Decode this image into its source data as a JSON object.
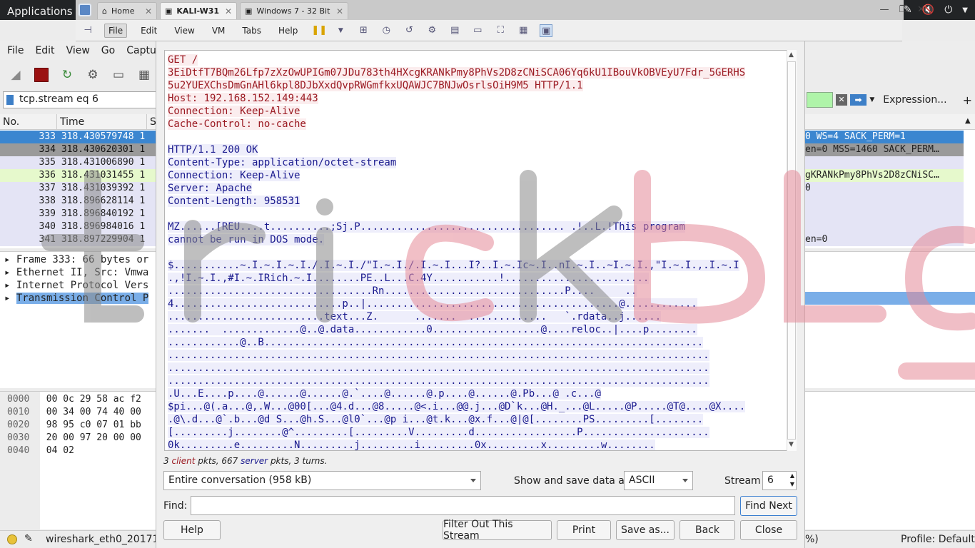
{
  "os": {
    "applications_label": "Applications"
  },
  "vm_tabs": [
    {
      "label": "Home"
    },
    {
      "label": "KALI-W31"
    },
    {
      "label": "Windows 7 - 32 Bit"
    }
  ],
  "vm_menu": [
    "File",
    "Edit",
    "View",
    "VM",
    "Tabs",
    "Help"
  ],
  "ws_menu": [
    "File",
    "Edit",
    "View",
    "Go",
    "Capture"
  ],
  "filter": {
    "text": "tcp.stream eq 6",
    "expression_label": "Expression...",
    "plus": "+"
  },
  "packet_columns": [
    "No.",
    "Time",
    "S"
  ],
  "packets": [
    {
      "no": "333",
      "time": "318.430579748",
      "src": "1"
    },
    {
      "no": "334",
      "time": "318.430620301",
      "src": "1"
    },
    {
      "no": "335",
      "time": "318.431006890",
      "src": "1"
    },
    {
      "no": "336",
      "time": "318.431031455",
      "src": "1"
    },
    {
      "no": "337",
      "time": "318.431039392",
      "src": "1"
    },
    {
      "no": "338",
      "time": "318.896628114",
      "src": "1"
    },
    {
      "no": "339",
      "time": "318.896840192",
      "src": "1"
    },
    {
      "no": "340",
      "time": "318.896984016",
      "src": "1"
    },
    {
      "no": "341",
      "time": "318.897229904",
      "src": "1"
    }
  ],
  "packet_info_right": [
    "0 WS=4 SACK_PERM=1",
    "en=0 MSS=1460 SACK_PERM…",
    "",
    "gKRANkPmy8PhVs2D8zCNiSC…",
    "0",
    "",
    "",
    "",
    "en=0"
  ],
  "details": [
    "Frame 333: 66 bytes or",
    "Ethernet II, Src: Vmwa",
    "Internet Protocol Vers",
    "Transmission Control P"
  ],
  "hex": [
    {
      "off": "0000",
      "bytes": "00 0c 29 58 ac f2"
    },
    {
      "off": "0010",
      "bytes": "00 34 00 74 40 00"
    },
    {
      "off": "0020",
      "bytes": "98 95 c0 07 01 bb"
    },
    {
      "off": "0030",
      "bytes": "20 00 97 20 00 00"
    },
    {
      "off": "0040",
      "bytes": "04 02"
    }
  ],
  "status": {
    "file": "wireshark_eth0_20171",
    "percent": "%)",
    "profile": "Profile: Default"
  },
  "stream": {
    "lines": [
      {
        "t": "c",
        "text": "GET /"
      },
      {
        "t": "c",
        "text": "3EiDtfT7BQm26Lfp7zXzOwUPIGm07JDu783th4HXcgKRANkPmy8PhVs2D8zCNiSCA06Yq6kU1IBouVkOBVEyU7Fdr_5GERHS"
      },
      {
        "t": "c",
        "text": "5u2YUEXChsDmGnAHl6kpl8DJbXxdQvpRWGmfkxUQAWJC7BNJwOsrlsOiH9M5 HTTP/1.1"
      },
      {
        "t": "c",
        "text": "Host: 192.168.152.149:443"
      },
      {
        "t": "c",
        "text": "Connection: Keep-Alive"
      },
      {
        "t": "c",
        "text": "Cache-Control: no-cache"
      },
      {
        "t": "b",
        "text": ""
      },
      {
        "t": "s",
        "text": "HTTP/1.1 200 OK"
      },
      {
        "t": "s",
        "text": "Content-Type: application/octet-stream"
      },
      {
        "t": "s",
        "text": "Connection: Keep-Alive"
      },
      {
        "t": "s",
        "text": "Server: Apache"
      },
      {
        "t": "s",
        "text": "Content-Length: 958531"
      },
      {
        "t": "b",
        "text": ""
      },
      {
        "t": "s",
        "text": "MZ......[REU....t..........;Sj.P.................................. .!..L.!This program"
      },
      {
        "t": "s",
        "text": "cannot be run in DOS mode."
      },
      {
        "t": "b",
        "text": ""
      },
      {
        "t": "s",
        "text": "$...........~.I.~.I.~.I./.I.~.I./\"I.~.I./.I.~.I...I?..I.~.Ic~.I..nI.~.I..~I.~.I.,\"I.~.I.,.I.~.I"
      },
      {
        "t": "s",
        "text": ".,!I.~.I.,#I.~.IRich.~.I........PE..L...C.4Y...........!........................"
      },
      {
        "t": "s",
        "text": "..................................Rn..............................P....     .."
      },
      {
        "t": "s",
        "text": "4............................p..|..........................................@............"
      },
      {
        "t": "s",
        "text": "..........................text...Z.      .......  .............   `.rdata..j......"
      },
      {
        "t": "s",
        "text": ".......  .............@..@.data............0..................@....reloc..|....p........"
      },
      {
        "t": "s",
        "text": "............@..B........................................................................."
      },
      {
        "t": "s",
        "text": ".........................................................................................."
      },
      {
        "t": "s",
        "text": ".........................................................................................."
      },
      {
        "t": "s",
        "text": ".........................................................................................."
      },
      {
        "t": "s",
        "text": ".U...E....p....@......@......@.`....@......@.p....@......@.Pb...@ .c...@"
      },
      {
        "t": "s",
        "text": "$pi...@(.a...@,.W...@00[...@4.d...@8.....@<.i...@@.j...@D`k...@H._...@L.....@P.....@T@....@X...."
      },
      {
        "t": "s",
        "text": ".@\\.d...@`.b...@d S...@h.S...@l0`...@p i...@t.k...@x.f...@|@[........PS.........[........"
      },
      {
        "t": "s",
        "text": "[.........j........@^.........[.........V.........d.................P....................."
      },
      {
        "t": "s",
        "text": "0k.........e.........N.........j.........i.........0x.........x.........w........"
      }
    ],
    "summary": {
      "client_count": "3",
      "client_word": "client",
      "mid": " pkts, 667 ",
      "server_word": "server",
      "tail": " pkts, 3 turns."
    },
    "conversation": "Entire conversation (958 kB)",
    "show_label": "Show and save data as",
    "format": "ASCII",
    "stream_label": "Stream",
    "stream_value": "6",
    "find_label": "Find:",
    "find_value": "",
    "buttons": {
      "find_next": "Find Next",
      "help": "Help",
      "filter_out": "Filter Out This Stream",
      "print": "Print",
      "save_as": "Save as...",
      "back": "Back",
      "close": "Close"
    }
  },
  "watermark": {
    "text": "trickbl",
    "colors": [
      "#8a8a8a",
      "#e58a98"
    ]
  }
}
